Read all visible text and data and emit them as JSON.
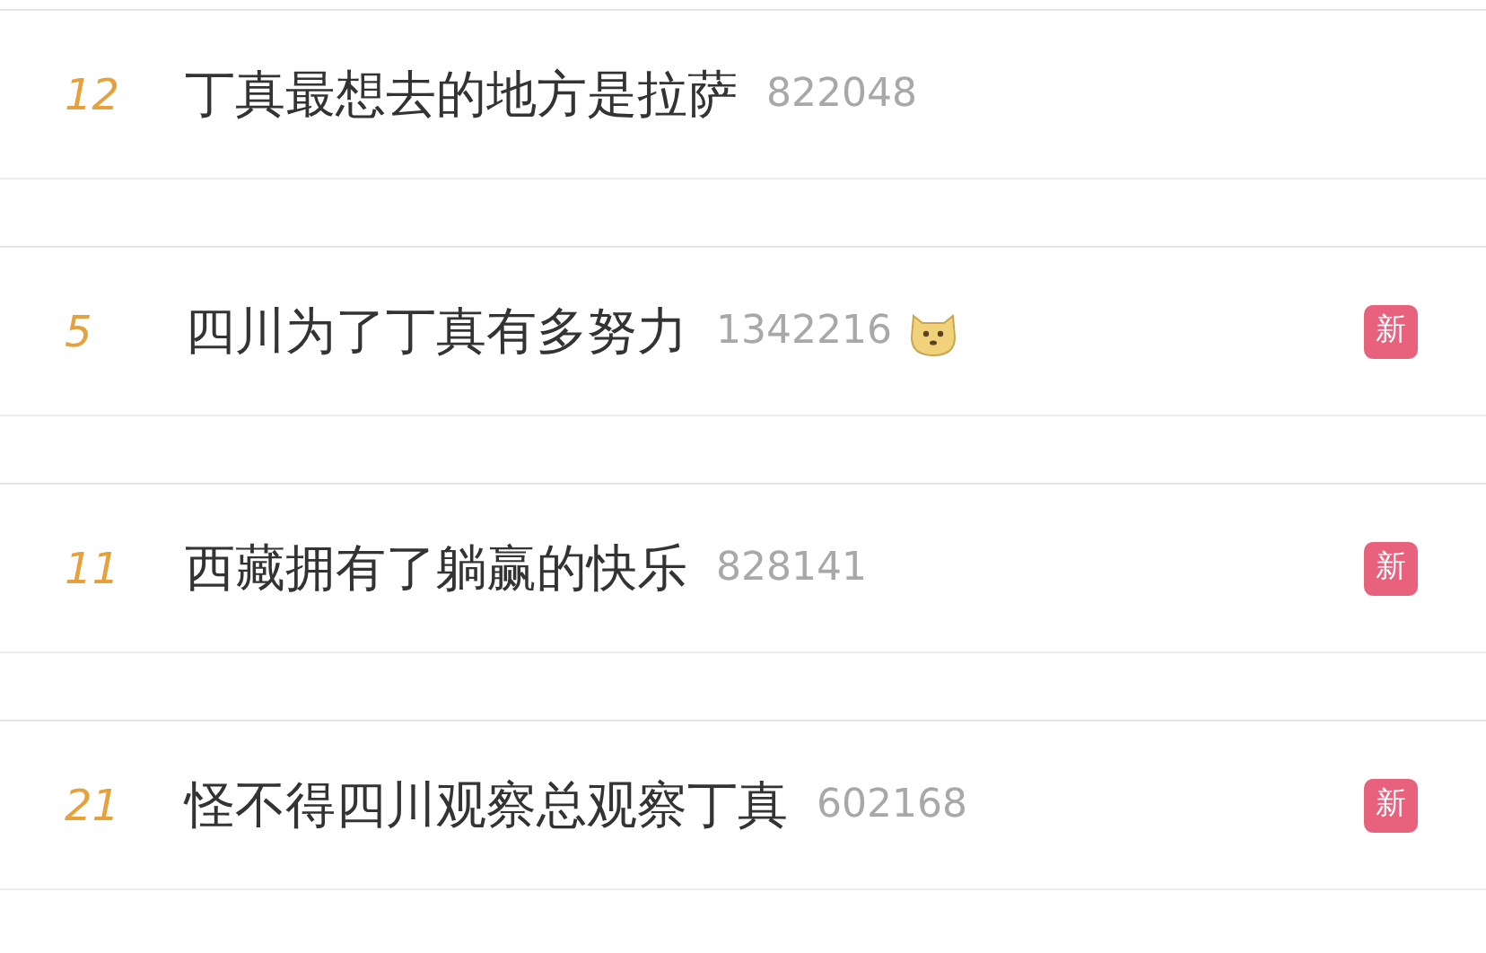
{
  "hot_search_items": [
    {
      "rank": "12",
      "title": "丁真最想去的地方是拉萨",
      "count": "822048",
      "emoji": false
    },
    {
      "rank": "5",
      "title": "四川为了丁真有多努力",
      "count": "1342216",
      "emoji": true,
      "badge": "新"
    },
    {
      "rank": "11",
      "title": "西藏拥有了躺赢的快乐",
      "count": "828141",
      "emoji": false,
      "badge": "新"
    },
    {
      "rank": "21",
      "title": "怪不得四川观察总观察丁真",
      "count": "602168",
      "emoji": false,
      "badge": "新"
    }
  ]
}
